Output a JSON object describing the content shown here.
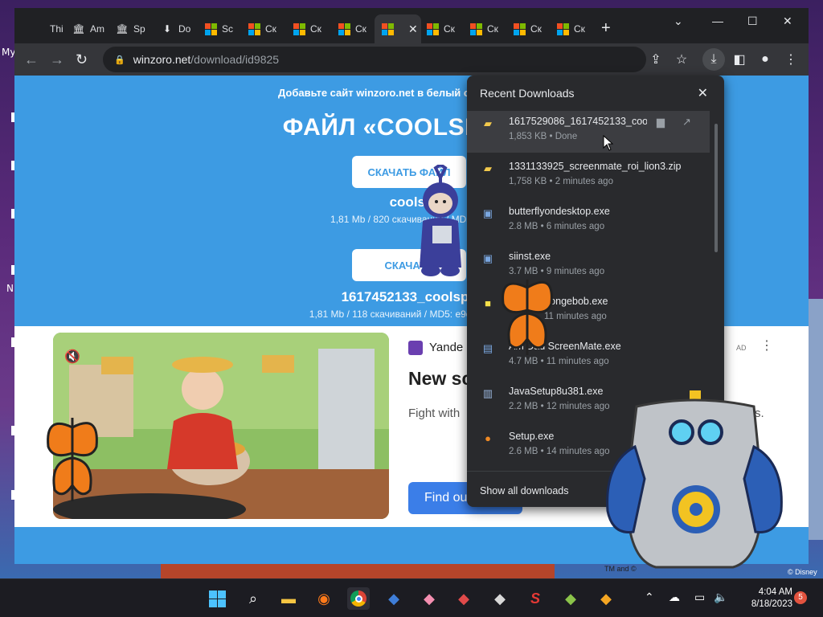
{
  "desktop": {
    "labels": [
      "My",
      "N"
    ]
  },
  "browser": {
    "tabs": [
      {
        "label": "Thi",
        "icon": "page-icon"
      },
      {
        "label": "Am",
        "icon": "institution-icon"
      },
      {
        "label": "Sp",
        "icon": "institution-icon"
      },
      {
        "label": "Do",
        "icon": "download-icon"
      },
      {
        "label": "Sc",
        "icon": "windows-logo-icon"
      },
      {
        "label": "Ск",
        "icon": "windows-logo-icon"
      },
      {
        "label": "Ск",
        "icon": "windows-logo-icon"
      },
      {
        "label": "Ск",
        "icon": "windows-logo-icon"
      },
      {
        "label": "",
        "icon": "windows-logo-icon"
      },
      {
        "label": "Ск",
        "icon": "windows-logo-icon"
      },
      {
        "label": "Ск",
        "icon": "windows-logo-icon"
      },
      {
        "label": "Ск",
        "icon": "windows-logo-icon"
      },
      {
        "label": "Ск",
        "icon": "windows-logo-icon"
      }
    ],
    "url_domain": "winzoro.net",
    "url_path": "/download/id9825"
  },
  "page": {
    "notice": "Добавьте сайт winzoro.net в белый список AdBlock",
    "title": "ФАЙЛ «COOLSPOT D",
    "download_btn_1": "СКАЧАТЬ ФАЙЛ",
    "file1_name": "coolsp",
    "file1_meta": "1,81 Mb / 820 скачиваний / MD5: e9c",
    "download_btn_2": "СКАЧАТЬ",
    "file2_name": "1617452133_coolspot",
    "file2_meta": "1,81 Mb / 118 скачиваний / MD5: e9cb36a2592",
    "ad_brand": "Yande",
    "ad_headline": "New sc",
    "ad_body": "Fight with",
    "ad_body_end": "eads.",
    "ad_cta": "Find ou",
    "ad_badge": "AD"
  },
  "downloads": {
    "title": "Recent Downloads",
    "items": [
      {
        "name": "1617529086_1617452133_coo",
        "status": "1,853 KB • Done",
        "icon": "folder-zip-icon"
      },
      {
        "name": "1331133925_screenmate_roi_lion3.zip",
        "status": "1,758 KB • 2 minutes ago",
        "icon": "folder-zip-icon"
      },
      {
        "name": "butterflyondesktop.exe",
        "status": "2.8 MB • 6 minutes ago",
        "icon": "installer-icon"
      },
      {
        "name": "siinst.exe",
        "status": "3.7 MB • 9 minutes ago",
        "icon": "installer-icon"
      },
      {
        "name": "spongebob.exe",
        "status": "11 minutes ago",
        "icon": "spongebob-icon"
      },
      {
        "name": "Am   Dad ScreenMate.exe",
        "status": "4.7 MB • 11 minutes ago",
        "icon": "window-app-icon"
      },
      {
        "name": "JavaSetup8u381.exe",
        "status": "2.2 MB • 12 minutes ago",
        "icon": "java-icon"
      },
      {
        "name": "Setup.exe",
        "status": "2.6 MB • 14 minutes ago",
        "icon": "setup-icon"
      }
    ],
    "show_all": "Show all downloads"
  },
  "taskbar": {
    "time": "4:04 AM",
    "date": "8/18/2023",
    "notifications": "5"
  },
  "overlays": {
    "copyright": "© Disney",
    "tm": "TM and ©"
  }
}
